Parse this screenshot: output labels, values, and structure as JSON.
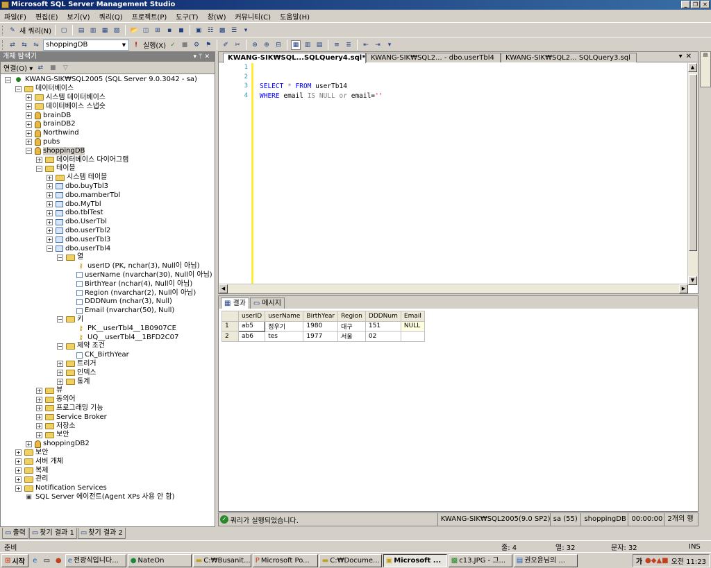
{
  "window": {
    "title": "Microsoft SQL Server Management Studio"
  },
  "menu": [
    "파일(F)",
    "편집(E)",
    "보기(V)",
    "쿼리(Q)",
    "프로젝트(P)",
    "도구(T)",
    "창(W)",
    "커뮤니티(C)",
    "도움말(H)"
  ],
  "toolbar1": {
    "new_query": "새 쿼리(N)"
  },
  "toolbar2": {
    "database": "shoppingDB",
    "execute": "실행(X)"
  },
  "object_explorer": {
    "title": "개체 탐색기",
    "connect": "연결(O)",
    "nodes": [
      {
        "label": "KWANG-SIK₩SQL2005 (SQL Server 9.0.3042 - sa)",
        "icon": "server-icon",
        "exp": "-"
      },
      {
        "label": "데이터베이스",
        "icon": "folder-icon",
        "exp": "-"
      },
      {
        "label": "시스템 데이터베이스",
        "icon": "folder-icon",
        "exp": "+"
      },
      {
        "label": "데이터베이스 스냅숏",
        "icon": "folder-icon",
        "exp": "+"
      },
      {
        "label": "brainDB",
        "icon": "database-icon",
        "exp": "+"
      },
      {
        "label": "brainDB2",
        "icon": "database-icon",
        "exp": "+"
      },
      {
        "label": "Northwind",
        "icon": "database-icon",
        "exp": "+"
      },
      {
        "label": "pubs",
        "icon": "database-icon",
        "exp": "+"
      },
      {
        "label": "shoppingDB",
        "icon": "database-icon",
        "exp": "-",
        "selected": true
      },
      {
        "label": "데이터베이스 다이어그램",
        "icon": "folder-icon",
        "exp": "+"
      },
      {
        "label": "테이블",
        "icon": "folder-icon",
        "exp": "-"
      },
      {
        "label": "시스템 테이블",
        "icon": "folder-icon",
        "exp": "+"
      },
      {
        "label": "dbo.buyTbl3",
        "icon": "table-icon",
        "exp": "+"
      },
      {
        "label": "dbo.mamberTbl",
        "icon": "table-icon",
        "exp": "+"
      },
      {
        "label": "dbo.MyTbl",
        "icon": "table-icon",
        "exp": "+"
      },
      {
        "label": "dbo.tblTest",
        "icon": "table-icon",
        "exp": "+"
      },
      {
        "label": "dbo.UserTbl",
        "icon": "table-icon",
        "exp": "+"
      },
      {
        "label": "dbo.userTbl2",
        "icon": "table-icon",
        "exp": "+"
      },
      {
        "label": "dbo.userTbl3",
        "icon": "table-icon",
        "exp": "+"
      },
      {
        "label": "dbo.userTbl4",
        "icon": "table-icon",
        "exp": "-"
      },
      {
        "label": "열",
        "icon": "folder-icon",
        "exp": "-"
      },
      {
        "label": "userID (PK, nchar(3), Null이 아님)",
        "icon": "key-icon",
        "exp": ""
      },
      {
        "label": "userName (nvarchar(30), Null이 아님)",
        "icon": "column-icon",
        "exp": ""
      },
      {
        "label": "BirthYear (nchar(4), Null이 아님)",
        "icon": "column-icon",
        "exp": ""
      },
      {
        "label": "Region (nvarchar(2), Null이 아님)",
        "icon": "column-icon",
        "exp": ""
      },
      {
        "label": "DDDNum (nchar(3), Null)",
        "icon": "column-icon",
        "exp": ""
      },
      {
        "label": "Email (nvarchar(50), Null)",
        "icon": "column-icon",
        "exp": ""
      },
      {
        "label": "키",
        "icon": "folder-icon",
        "exp": "-"
      },
      {
        "label": "PK__userTbl4__1B0907CE",
        "icon": "key-icon",
        "exp": ""
      },
      {
        "label": "UQ__userTbl4__1BFD2C07",
        "icon": "key-icon",
        "exp": ""
      },
      {
        "label": "제약 조건",
        "icon": "folder-icon",
        "exp": "-"
      },
      {
        "label": "CK_BirthYear",
        "icon": "column-icon",
        "exp": ""
      },
      {
        "label": "트리거",
        "icon": "folder-icon",
        "exp": "+"
      },
      {
        "label": "인덱스",
        "icon": "folder-icon",
        "exp": "+"
      },
      {
        "label": "통계",
        "icon": "folder-icon",
        "exp": "+"
      },
      {
        "label": "뷰",
        "icon": "folder-icon",
        "exp": "+"
      },
      {
        "label": "동의어",
        "icon": "folder-icon",
        "exp": "+"
      },
      {
        "label": "프로그래밍 기능",
        "icon": "folder-icon",
        "exp": "+"
      },
      {
        "label": "Service Broker",
        "icon": "folder-icon",
        "exp": "+"
      },
      {
        "label": "저장소",
        "icon": "folder-icon",
        "exp": "+"
      },
      {
        "label": "보안",
        "icon": "folder-icon",
        "exp": "+"
      },
      {
        "label": "shoppingDB2",
        "icon": "database-icon",
        "exp": "+"
      },
      {
        "label": "보안",
        "icon": "folder-icon",
        "exp": "+"
      },
      {
        "label": "서버 개체",
        "icon": "folder-icon",
        "exp": "+"
      },
      {
        "label": "복제",
        "icon": "folder-icon",
        "exp": "+"
      },
      {
        "label": "관리",
        "icon": "folder-icon",
        "exp": "+"
      },
      {
        "label": "Notification Services",
        "icon": "folder-icon",
        "exp": "+"
      },
      {
        "label": "SQL Server 에이전트(Agent XPs 사용 안 함)",
        "icon": "agent-icon",
        "exp": ""
      }
    ]
  },
  "editor": {
    "tabs": [
      "KWANG-SIK₩SQL...SQLQuery4.sql*",
      "KWANG-SIK₩SQL2... - dbo.userTbl4",
      "KWANG-SIK₩SQL2... SQLQuery3.sql"
    ],
    "line_numbers": [
      "1",
      "2",
      "3",
      "4"
    ],
    "code": {
      "l3_kw1": "SELECT",
      "l3_star": "*",
      "l3_kw2": "FROM",
      "l3_tbl": "userTb14",
      "l4_kw1": "WHERE",
      "l4_col1": "email",
      "l4_op1": "IS",
      "l4_op2": "NULL",
      "l4_op3": "or",
      "l4_col2": "email=",
      "l4_str": "''"
    }
  },
  "results": {
    "tabs": [
      "결과",
      "메시지"
    ],
    "columns": [
      "userID",
      "userName",
      "BirthYear",
      "Region",
      "DDDNum",
      "Email"
    ],
    "rows": [
      {
        "n": "1",
        "cells": [
          "ab5",
          "정우기",
          "1980",
          "대구",
          "151",
          "NULL"
        ]
      },
      {
        "n": "2",
        "cells": [
          "ab6",
          "tes",
          "1977",
          "서울",
          "02",
          ""
        ]
      }
    ]
  },
  "query_status": {
    "message": "쿼리가 실행되었습니다.",
    "server": "KWANG-SIK₩SQL2005(9.0 SP2)",
    "user": "sa (55)",
    "database": "shoppingDB",
    "time": "00:00:00",
    "rows": "2개의 행"
  },
  "bottom_tabs": [
    "출력",
    "찾기 결과 1",
    "찾기 결과 2"
  ],
  "statusbar": {
    "ready": "준비",
    "line": "줄: 4",
    "col": "열: 32",
    "ch": "문자: 32",
    "ins": "INS"
  },
  "taskbar": {
    "start": "시작",
    "tasks": [
      "전광식입니다...",
      "NateOn",
      "C:₩Busanit...",
      "Microsoft Po...",
      "C:₩Docume...",
      "Microsoft ...",
      "c13.JPG - 그...",
      "권오윤님의 ..."
    ],
    "active_index": 5,
    "ime": "가",
    "clock": "오전 11:23"
  }
}
